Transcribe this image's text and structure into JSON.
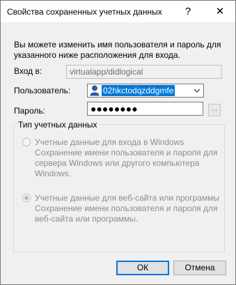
{
  "window": {
    "title": "Свойства сохраненных учетных данных",
    "help": "?",
    "close": "✕"
  },
  "intro": "Вы можете изменить имя пользователя и пароль для указанного ниже расположения для входа.",
  "login": {
    "label": "Вход в:",
    "value": "virtualapp/didlogical"
  },
  "user": {
    "label": "Пользователь:",
    "value": "02hkctodqzddgmfe",
    "browse": "..."
  },
  "password": {
    "label": "Пароль:",
    "masked": "●●●●●●●●"
  },
  "credential_type": {
    "legend": "Тип учетных данных",
    "options": [
      {
        "label": "Учетные данные для входа в Windows",
        "description": "Сохранение имени пользователя и пароля для сервера Windows или другого компьютера Windows.",
        "selected": false
      },
      {
        "label": "Учетные данные для веб-сайта или программы",
        "description": "Сохранение имени пользователя и пароля для веб-сайта или программы.",
        "selected": true
      }
    ]
  },
  "buttons": {
    "ok": "ОК",
    "cancel": "Отмена"
  },
  "colors": {
    "selection": "#0078d7",
    "disabled_text": "#8d8d8d"
  }
}
